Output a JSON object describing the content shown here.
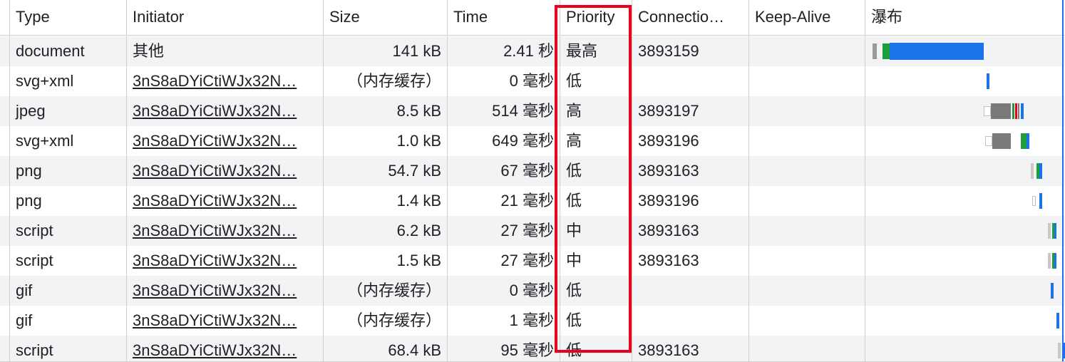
{
  "columns": {
    "type": "Type",
    "initiator": "Initiator",
    "size": "Size",
    "time": "Time",
    "priority": "Priority",
    "connection": "Connectio…",
    "keep_alive": "Keep-Alive",
    "waterfall": "瀑布"
  },
  "rows": [
    {
      "type": "document",
      "initiator": "其他",
      "initiator_link": false,
      "size": "141 kB",
      "time": "2.41 秒",
      "priority": "最高",
      "connection": "3893159",
      "keep_alive": ""
    },
    {
      "type": "svg+xml",
      "initiator": "3nS8aDYiCtiWJx32N…",
      "initiator_link": true,
      "size": "（内存缓存）",
      "time": "0 毫秒",
      "priority": "低",
      "connection": "",
      "keep_alive": ""
    },
    {
      "type": "jpeg",
      "initiator": "3nS8aDYiCtiWJx32N…",
      "initiator_link": true,
      "size": "8.5 kB",
      "time": "514 毫秒",
      "priority": "高",
      "connection": "3893197",
      "keep_alive": ""
    },
    {
      "type": "svg+xml",
      "initiator": "3nS8aDYiCtiWJx32N…",
      "initiator_link": true,
      "size": "1.0 kB",
      "time": "649 毫秒",
      "priority": "高",
      "connection": "3893196",
      "keep_alive": ""
    },
    {
      "type": "png",
      "initiator": "3nS8aDYiCtiWJx32N…",
      "initiator_link": true,
      "size": "54.7 kB",
      "time": "67 毫秒",
      "priority": "低",
      "connection": "3893163",
      "keep_alive": ""
    },
    {
      "type": "png",
      "initiator": "3nS8aDYiCtiWJx32N…",
      "initiator_link": true,
      "size": "1.4 kB",
      "time": "21 毫秒",
      "priority": "低",
      "connection": "3893196",
      "keep_alive": ""
    },
    {
      "type": "script",
      "initiator": "3nS8aDYiCtiWJx32N…",
      "initiator_link": true,
      "size": "6.2 kB",
      "time": "27 毫秒",
      "priority": "中",
      "connection": "3893163",
      "keep_alive": ""
    },
    {
      "type": "script",
      "initiator": "3nS8aDYiCtiWJx32N…",
      "initiator_link": true,
      "size": "1.5 kB",
      "time": "27 毫秒",
      "priority": "中",
      "connection": "3893163",
      "keep_alive": ""
    },
    {
      "type": "gif",
      "initiator": "3nS8aDYiCtiWJx32N…",
      "initiator_link": true,
      "size": "（内存缓存）",
      "time": "0 毫秒",
      "priority": "低",
      "connection": "",
      "keep_alive": ""
    },
    {
      "type": "gif",
      "initiator": "3nS8aDYiCtiWJx32N…",
      "initiator_link": true,
      "size": "（内存缓存）",
      "time": "1 毫秒",
      "priority": "低",
      "connection": "",
      "keep_alive": ""
    },
    {
      "type": "script",
      "initiator": "3nS8aDYiCtiWJx32N…",
      "initiator_link": true,
      "size": "68.4 kB",
      "time": "95 毫秒",
      "priority": "低",
      "connection": "3893163",
      "keep_alive": ""
    }
  ],
  "colors": {
    "highlight_border": "#e8001c",
    "waterfall_blue": "#1a73e8",
    "waterfall_green": "#1e9e3a",
    "waterfall_gray": "#7a7a7a",
    "row_stripe": "#f1f3f4"
  }
}
